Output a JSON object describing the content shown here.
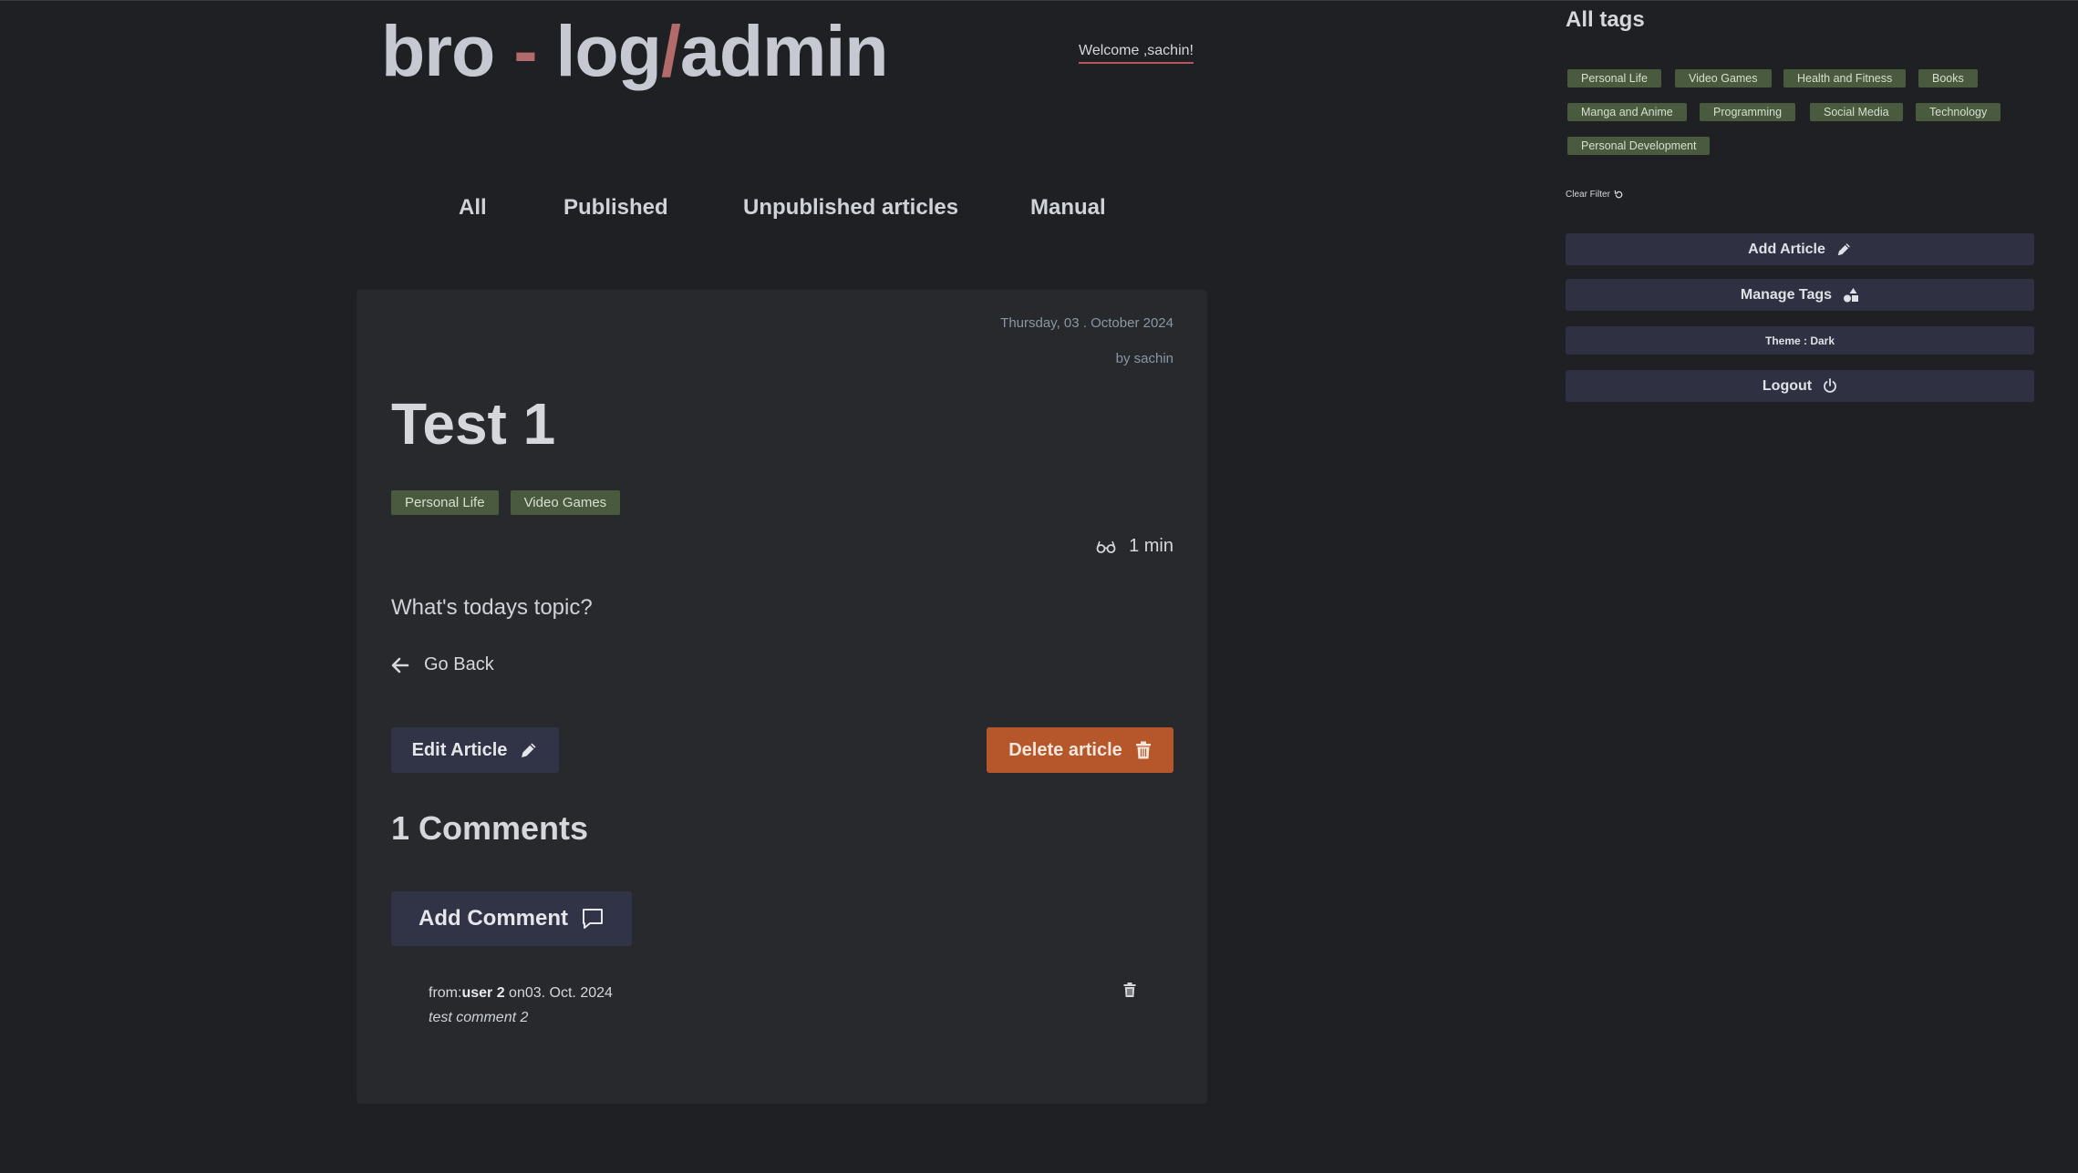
{
  "header": {
    "logo_part1": "bro ",
    "logo_part2": "-",
    "logo_part3": " log",
    "logo_part4": "/",
    "logo_part5": "admin",
    "welcome": "Welcome ,sachin!"
  },
  "nav": {
    "all": "All",
    "published": "Published",
    "unpublished": "Unpublished articles",
    "manual": "Manual"
  },
  "article": {
    "date": "Thursday, 03 . October 2024",
    "author": "by sachin",
    "title": "Test 1",
    "tags": [
      "Personal Life",
      "Video Games"
    ],
    "read_time": "1 min",
    "body": "What's todays topic?",
    "go_back": "Go Back",
    "edit_label": "Edit Article",
    "delete_label": "Delete article"
  },
  "comments": {
    "heading": "1 Comments",
    "add_label": "Add Comment",
    "items": [
      {
        "from_label": "from:",
        "user": "user 2",
        "on_label": " on",
        "date": "03. Oct. 2024",
        "text": "test comment 2"
      }
    ]
  },
  "sidebar": {
    "title": "All tags",
    "tags": [
      "Personal Life",
      "Video Games",
      "Health and Fitness",
      "Books",
      "Manga and Anime",
      "Programming",
      "Social Media",
      "Technology",
      "Personal Development"
    ],
    "clear_filter": "Clear Filter",
    "add_article": "Add Article",
    "manage_tags": "Manage Tags",
    "theme": "Theme : Dark",
    "logout": "Logout"
  },
  "colors": {
    "background": "#1f2023",
    "card": "#27292d",
    "tag_bg": "#4a5a3f",
    "accent_red": "#b26a6a",
    "delete_orange": "#b5572a",
    "button_bg": "#313346"
  },
  "icons": {
    "read_time": "glasses-icon",
    "go_back": "arrow-left-icon",
    "edit": "pencil-icon",
    "delete": "trash-icon",
    "add_comment": "comment-icon",
    "clear_filter": "refresh-icon",
    "manage_tags": "shapes-icon",
    "logout": "power-icon"
  }
}
